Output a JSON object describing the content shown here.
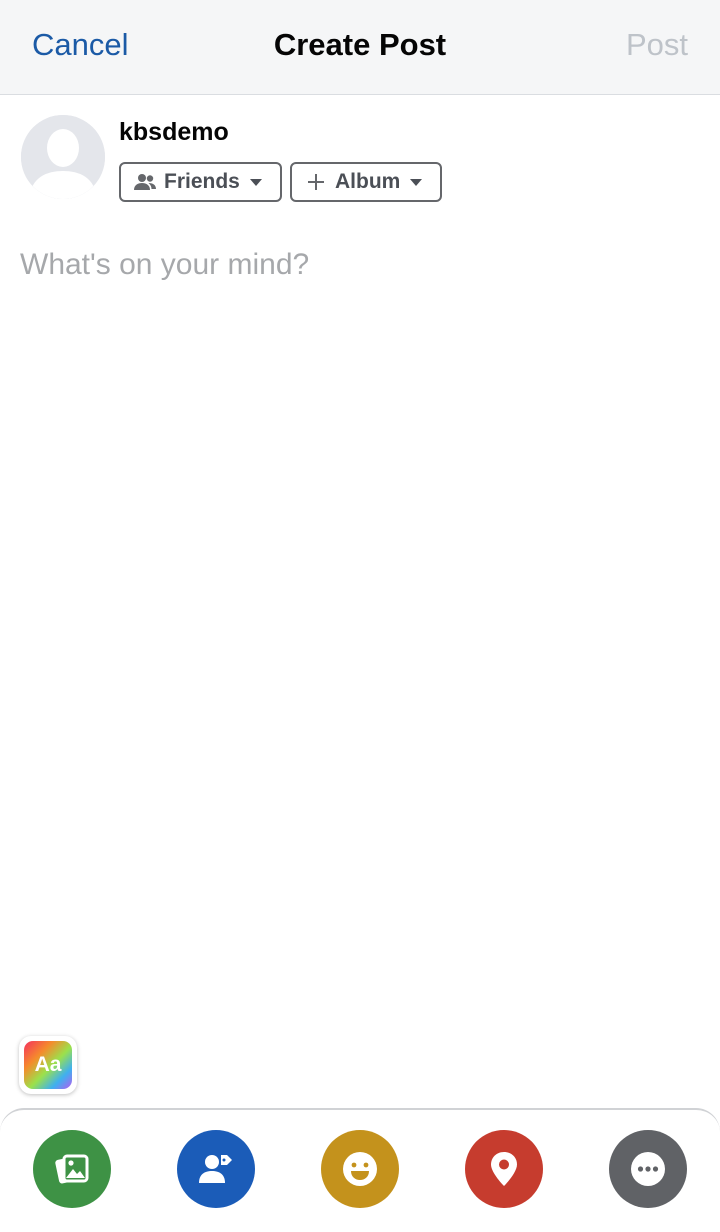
{
  "nav": {
    "cancel_label": "Cancel",
    "title": "Create Post",
    "post_label": "Post"
  },
  "composer": {
    "username": "kbsdemo",
    "audience_label": "Friends",
    "album_label": "Album",
    "placeholder": "What's on your mind?",
    "text_style_label": "Aa"
  },
  "actions": [
    {
      "name": "photo",
      "icon": "photo-gallery-icon",
      "color": "#3e9245"
    },
    {
      "name": "tag-people",
      "icon": "tag-person-icon",
      "color": "#1b5cb8"
    },
    {
      "name": "feeling",
      "icon": "smiley-icon",
      "color": "#c4921c"
    },
    {
      "name": "check-in",
      "icon": "location-pin-icon",
      "color": "#c63c2e"
    },
    {
      "name": "more",
      "icon": "more-dots-icon",
      "color": "#606266"
    }
  ],
  "colors": {
    "link_blue": "#1b5aa6",
    "disabled_gray": "#bec3c9",
    "nav_background": "#f5f6f7"
  }
}
